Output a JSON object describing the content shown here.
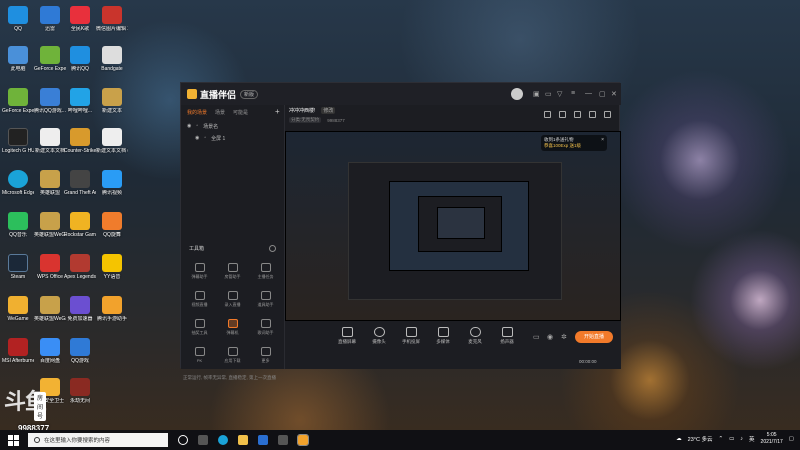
{
  "desktop": {
    "icons": [
      {
        "label": "QQ",
        "color": "#1f8fe0"
      },
      {
        "label": "全民K歌",
        "color": "#e8303c"
      },
      {
        "label": "微信图片编辑 2021071...",
        "color": "#c9342c"
      },
      {
        "label": "此电脑",
        "color": "#4a90d9"
      },
      {
        "label": "迅雷",
        "color": "#2f7ad6"
      },
      {
        "label": "腾讯QQ",
        "color": "#1f8fe0"
      },
      {
        "label": "Bandgate",
        "color": "#dddddd"
      },
      {
        "label": "GeForce Experience",
        "color": "#6fb33a"
      },
      {
        "label": "腾讯QQ游戏...",
        "color": "#3a7fd6"
      },
      {
        "label": "哔哩哔哩...",
        "color": "#22a3e6"
      },
      {
        "label": "新建文本",
        "color": "#ddd"
      },
      {
        "label": "Logitech G HUB",
        "color": "#222"
      },
      {
        "label": "新建文本文档",
        "color": "#eee"
      },
      {
        "label": "Counter-Strike Global...",
        "color": "#d89a2c"
      },
      {
        "label": "新建文本文档 (2)",
        "color": "#eee"
      },
      {
        "label": "Microsoft Edge",
        "color": "#1aa3d8"
      },
      {
        "label": "英雄联盟",
        "color": "#c8a14a"
      },
      {
        "label": "Grand Theft Auto V",
        "color": "#444"
      },
      {
        "label": "腾讯视频",
        "color": "#2a9cf5"
      },
      {
        "label": "QQ音乐",
        "color": "#2cbf5c"
      },
      {
        "label": "英雄联盟WeGame版",
        "color": "#c8a14a"
      },
      {
        "label": "Rockstar Games...",
        "color": "#f0b322"
      },
      {
        "label": "QQ旋舞",
        "color": "#f07c2c"
      },
      {
        "label": "Steam",
        "color": "#1b2838"
      },
      {
        "label": "WPS Office",
        "color": "#d9342f"
      },
      {
        "label": "Apex Legends",
        "color": "#b23a30"
      },
      {
        "label": "YY语音",
        "color": "#f5c400"
      },
      {
        "label": "WeGame",
        "color": "#f0b030"
      },
      {
        "label": "英雄联盟WeGame版",
        "color": "#c8a14a"
      },
      {
        "label": "免费加速器",
        "color": "#6b4fd1"
      },
      {
        "label": "腾讯手游助手",
        "color": "#f2a22c"
      },
      {
        "label": "MSI Afterburner",
        "color": "#b22222"
      },
      {
        "label": "百度网盘",
        "color": "#3a8ef5"
      },
      {
        "label": "QQ游戏",
        "color": "#2f7ad6"
      },
      {
        "label": "360安全卫士",
        "color": "#f2b233"
      },
      {
        "label": "火绒安全",
        "color": "#e35a2b"
      },
      {
        "label": "永劫无间",
        "color": "#8a2a22"
      }
    ],
    "watermark": {
      "logo": "斗鱼",
      "room_label": "房间号",
      "room_number": "9988377"
    }
  },
  "app": {
    "name": "直播伴侣",
    "version_badge": "新版",
    "left_tabs": [
      "我的场景",
      "场景",
      "可能是"
    ],
    "scenes": [
      {
        "label": "场景名"
      },
      {
        "label": "全屏 1"
      }
    ],
    "toolbox_title": "工具箱",
    "tools": [
      {
        "label": "弹幕助手"
      },
      {
        "label": "房管助手"
      },
      {
        "label": "主播任务"
      },
      {
        "label": "视频直播"
      },
      {
        "label": "录入直播"
      },
      {
        "label": "道具助手"
      },
      {
        "label": "抽奖工具"
      },
      {
        "label": "弹幕机"
      },
      {
        "label": "歌词助手"
      },
      {
        "label": "PK"
      },
      {
        "label": "应用下载"
      },
      {
        "label": "更多"
      }
    ],
    "left_status": "正常运行, 帧率无异常, 直播稳定, 第上一次直播",
    "stream_title": "冲冲冲西楼!",
    "edit_label": "修改",
    "info": {
      "category": "分类:无畏契约",
      "room_id": "9988377"
    },
    "overlay": {
      "line1": "收到1条送礼物",
      "line2": "恭喜100Exp 送1级",
      "close": "×"
    },
    "bottom_tools": [
      {
        "label": "直播屏幕"
      },
      {
        "label": "摄像头"
      },
      {
        "label": "手机投屏"
      },
      {
        "label": "多媒体"
      },
      {
        "label": "麦克风"
      },
      {
        "label": "扬声器"
      }
    ],
    "start_button": "开始直播",
    "live_time": "00:00:00"
  },
  "taskbar": {
    "search_placeholder": "在这里输入你要搜索的内容",
    "weather": "23°C 多云",
    "time": "5:05",
    "date": "2021/7/17",
    "lang": "英"
  }
}
